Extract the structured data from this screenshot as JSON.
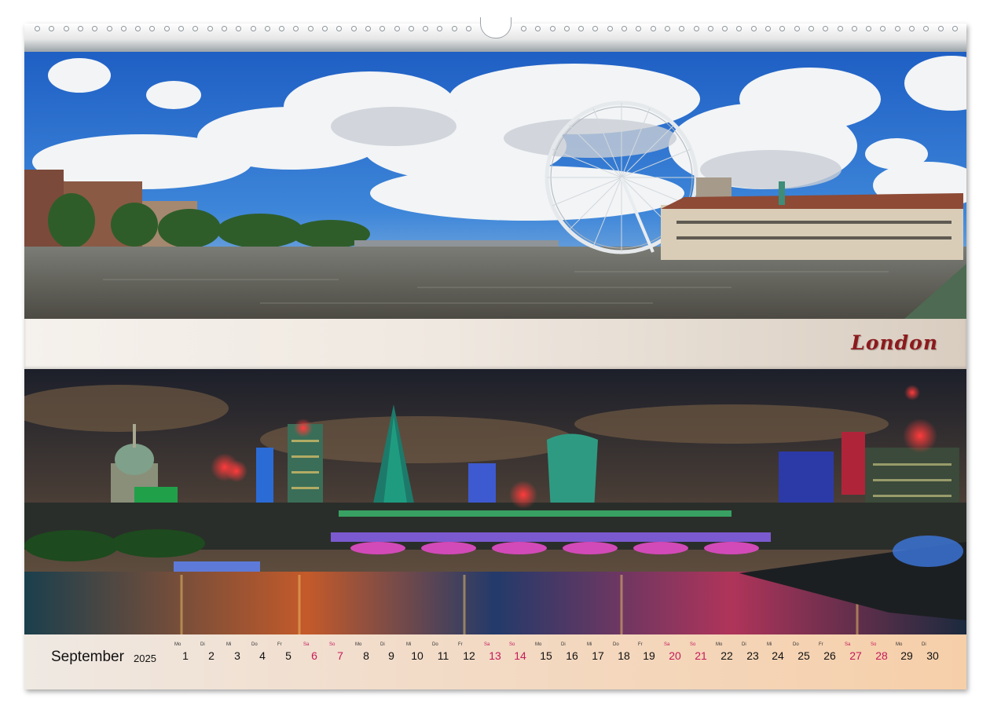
{
  "colors": {
    "accent_red": "#8c1a1d",
    "weekend": "#c41a5a"
  },
  "top_photo": {
    "alt": "River Thames with London Eye and County Hall"
  },
  "bottom_photo": {
    "alt": "London skyline at night with illuminated bridge"
  },
  "title": "London",
  "calendar": {
    "month": "September",
    "year": "2025",
    "days": [
      {
        "dow": "Mo",
        "n": "1",
        "we": false
      },
      {
        "dow": "Di",
        "n": "2",
        "we": false
      },
      {
        "dow": "Mi",
        "n": "3",
        "we": false
      },
      {
        "dow": "Do",
        "n": "4",
        "we": false
      },
      {
        "dow": "Fr",
        "n": "5",
        "we": false
      },
      {
        "dow": "Sa",
        "n": "6",
        "we": true
      },
      {
        "dow": "So",
        "n": "7",
        "we": true
      },
      {
        "dow": "Mo",
        "n": "8",
        "we": false
      },
      {
        "dow": "Di",
        "n": "9",
        "we": false
      },
      {
        "dow": "Mi",
        "n": "10",
        "we": false
      },
      {
        "dow": "Do",
        "n": "11",
        "we": false
      },
      {
        "dow": "Fr",
        "n": "12",
        "we": false
      },
      {
        "dow": "Sa",
        "n": "13",
        "we": true
      },
      {
        "dow": "So",
        "n": "14",
        "we": true
      },
      {
        "dow": "Mo",
        "n": "15",
        "we": false
      },
      {
        "dow": "Di",
        "n": "16",
        "we": false
      },
      {
        "dow": "Mi",
        "n": "17",
        "we": false
      },
      {
        "dow": "Do",
        "n": "18",
        "we": false
      },
      {
        "dow": "Fr",
        "n": "19",
        "we": false
      },
      {
        "dow": "Sa",
        "n": "20",
        "we": true
      },
      {
        "dow": "So",
        "n": "21",
        "we": true
      },
      {
        "dow": "Mo",
        "n": "22",
        "we": false
      },
      {
        "dow": "Di",
        "n": "23",
        "we": false
      },
      {
        "dow": "Mi",
        "n": "24",
        "we": false
      },
      {
        "dow": "Do",
        "n": "25",
        "we": false
      },
      {
        "dow": "Fr",
        "n": "26",
        "we": false
      },
      {
        "dow": "Sa",
        "n": "27",
        "we": true
      },
      {
        "dow": "So",
        "n": "28",
        "we": true
      },
      {
        "dow": "Mo",
        "n": "29",
        "we": false
      },
      {
        "dow": "Di",
        "n": "30",
        "we": false
      }
    ]
  }
}
